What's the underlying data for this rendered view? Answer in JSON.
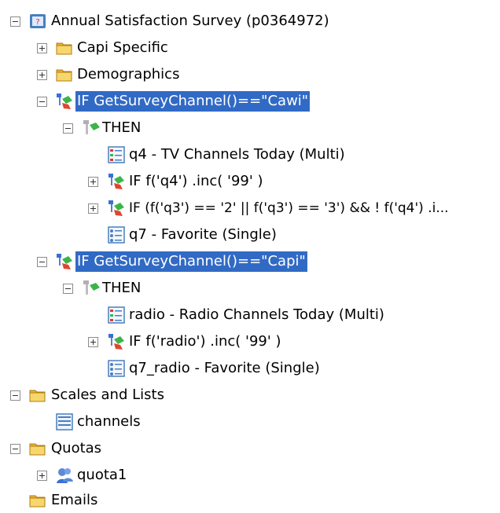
{
  "tree": {
    "root": {
      "label": "Annual Satisfaction Survey (p0364972)",
      "icon": "survey-icon"
    },
    "capi_specific": {
      "label": "Capi Specific",
      "icon": "folder-icon"
    },
    "demographics": {
      "label": "Demographics",
      "icon": "folder-icon"
    },
    "if_cawi": {
      "label": "IF GetSurveyChannel()==\"Cawi\"",
      "icon": "condition-icon",
      "selected": true
    },
    "then_cawi": {
      "label": "THEN",
      "icon": "then-icon"
    },
    "q4": {
      "label": "q4 - TV Channels Today (Multi)",
      "icon": "multi-question-icon"
    },
    "if_q4": {
      "label": "IF f('q4') .inc( '99' )",
      "icon": "condition-icon"
    },
    "if_q3": {
      "label": "IF (f('q3') == '2' || f('q3') == '3') && ! f('q4') .i...",
      "icon": "condition-icon"
    },
    "q7": {
      "label": "q7 - Favorite (Single)",
      "icon": "single-question-icon"
    },
    "if_capi": {
      "label": "IF GetSurveyChannel()==\"Capi\"",
      "icon": "condition-icon",
      "selected": true
    },
    "then_capi": {
      "label": "THEN",
      "icon": "then-icon"
    },
    "radio": {
      "label": "radio - Radio Channels Today (Multi)",
      "icon": "multi-question-icon"
    },
    "if_radio": {
      "label": "IF f('radio') .inc( '99' )",
      "icon": "condition-icon"
    },
    "q7_radio": {
      "label": "q7_radio - Favorite (Single)",
      "icon": "single-question-icon"
    },
    "scales_lists": {
      "label": "Scales and Lists",
      "icon": "folder-icon"
    },
    "channels": {
      "label": "channels",
      "icon": "list-icon"
    },
    "quotas": {
      "label": "Quotas",
      "icon": "folder-icon"
    },
    "quota1": {
      "label": "quota1",
      "icon": "quota-icon"
    },
    "emails": {
      "label": "Emails",
      "icon": "folder-icon"
    }
  },
  "colors": {
    "selection": "#316ac5",
    "folder": "#f4c542",
    "condition_blue": "#3b6fd6",
    "condition_green": "#3bb54a",
    "condition_red": "#e0462f"
  }
}
